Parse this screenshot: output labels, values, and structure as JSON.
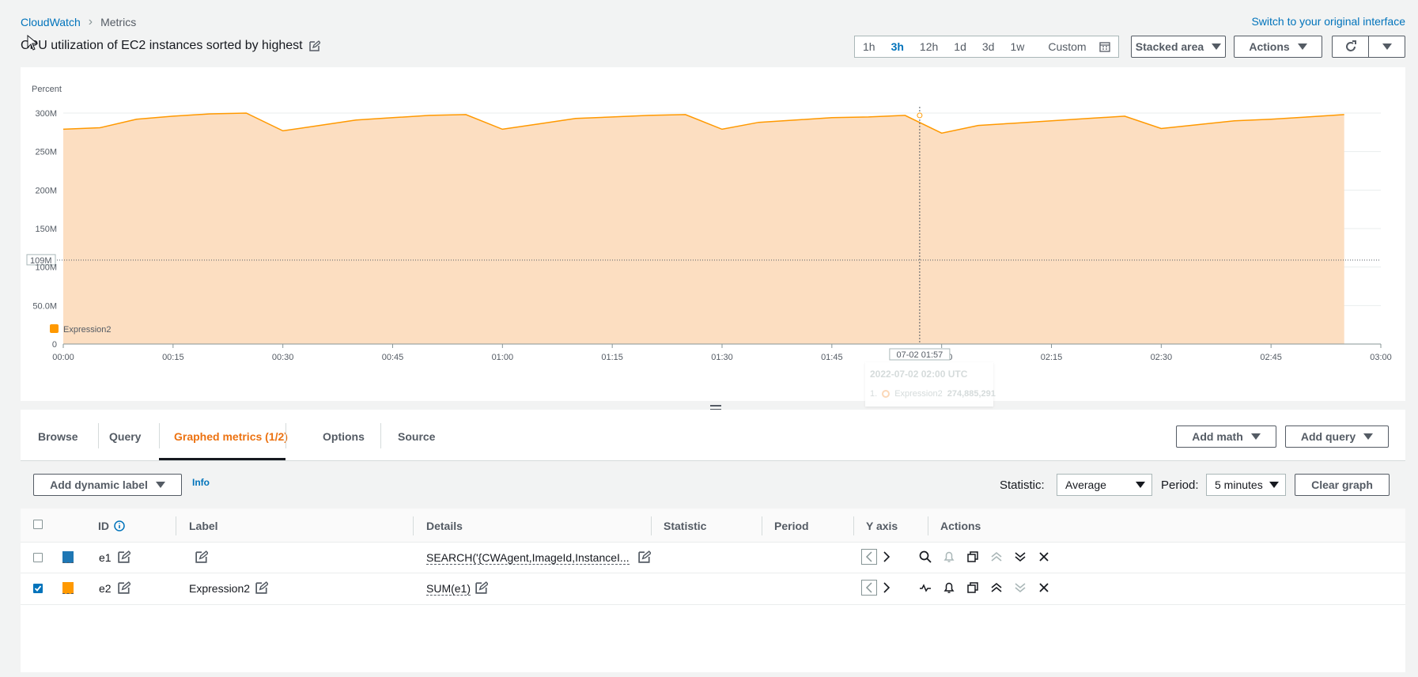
{
  "breadcrumb": {
    "root": "CloudWatch",
    "current": "Metrics"
  },
  "switch_link": "Switch to your original interface",
  "title": "CPU utilization of EC2 instances sorted by highest",
  "time_ranges": [
    "1h",
    "3h",
    "12h",
    "1d",
    "3d",
    "1w"
  ],
  "time_selected": "3h",
  "custom_label": "Custom",
  "chart_type_label": "Stacked area",
  "actions_label": "Actions",
  "chart_data": {
    "type": "area",
    "ylabel": "Percent",
    "yticks": [
      "0",
      "50.0M",
      "100M",
      "150M",
      "200M",
      "250M",
      "300M"
    ],
    "ytick_values": [
      0,
      50,
      100,
      150,
      200,
      250,
      300
    ],
    "ylim": [
      0,
      300
    ],
    "xticks": [
      "00:00",
      "00:15",
      "00:30",
      "00:45",
      "01:00",
      "01:15",
      "01:30",
      "01:45",
      "02:00",
      "02:15",
      "02:30",
      "02:45",
      "03:00"
    ],
    "xlim_minutes": [
      0,
      180
    ],
    "series": [
      {
        "name": "Expression2",
        "color": "#ff9900",
        "x": [
          0,
          5,
          10,
          15,
          20,
          25,
          30,
          35,
          40,
          45,
          50,
          55,
          60,
          65,
          70,
          75,
          80,
          85,
          90,
          95,
          100,
          105,
          110,
          115,
          120,
          125,
          130,
          135,
          140,
          145,
          150,
          155,
          160,
          165,
          170,
          175
        ],
        "values": [
          279,
          281,
          292,
          296,
          299,
          300,
          277,
          284,
          291,
          294,
          297,
          298,
          279,
          286,
          293,
          295,
          297,
          298,
          279,
          288,
          291,
          294,
          295,
          297,
          274,
          284,
          287,
          290,
          293,
          296,
          280,
          285,
          290,
          292,
          295,
          298
        ]
      }
    ],
    "threshold_label": "109M",
    "threshold_value": 109,
    "cursor_label": "07-02 01:57",
    "cursor_minute": 117,
    "tooltip": {
      "time": "2022-07-02 02:00 UTC",
      "index": "1.",
      "series": "Expression2",
      "value": "274,885,291"
    }
  },
  "tabs": [
    {
      "label": "Browse"
    },
    {
      "label": "Query"
    },
    {
      "label": "Graphed metrics (1/2)"
    },
    {
      "label": "Options"
    },
    {
      "label": "Source"
    }
  ],
  "add_math_label": "Add math",
  "add_query_label": "Add query",
  "dynamic_label_button": "Add dynamic label",
  "info_label": "Info",
  "statistic_label": "Statistic:",
  "statistic_value": "Average",
  "period_label": "Period:",
  "period_value": "5 minutes",
  "clear_graph_label": "Clear graph",
  "table": {
    "headers": {
      "id": "ID",
      "label": "Label",
      "details": "Details",
      "statistic": "Statistic",
      "period": "Period",
      "yaxis": "Y axis",
      "actions": "Actions"
    },
    "rows": [
      {
        "id": "e1",
        "label": "",
        "details": "SEARCH('{CWAgent,ImageId,InstanceI...",
        "color": "#1f77b4",
        "checked": false
      },
      {
        "id": "e2",
        "label": "Expression2",
        "details": "SUM(e1)",
        "color": "#ff9900",
        "checked": true
      }
    ]
  }
}
